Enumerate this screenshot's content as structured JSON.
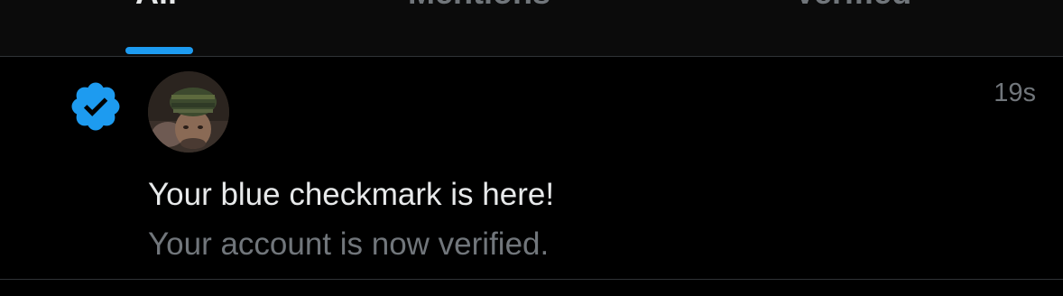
{
  "tabs": [
    {
      "label": "All",
      "active": true
    },
    {
      "label": "Mentions",
      "active": false
    },
    {
      "label": "Verified",
      "active": false
    }
  ],
  "notification": {
    "icon": "verified-badge-icon",
    "time": "19s",
    "title": "Your blue checkmark is here!",
    "subtitle": "Your account is now verified."
  },
  "colors": {
    "accent": "#1d9bf0",
    "background": "#000000",
    "primary_text": "#e7e9ea",
    "secondary_text": "#71767b",
    "divider": "#2f3336"
  }
}
